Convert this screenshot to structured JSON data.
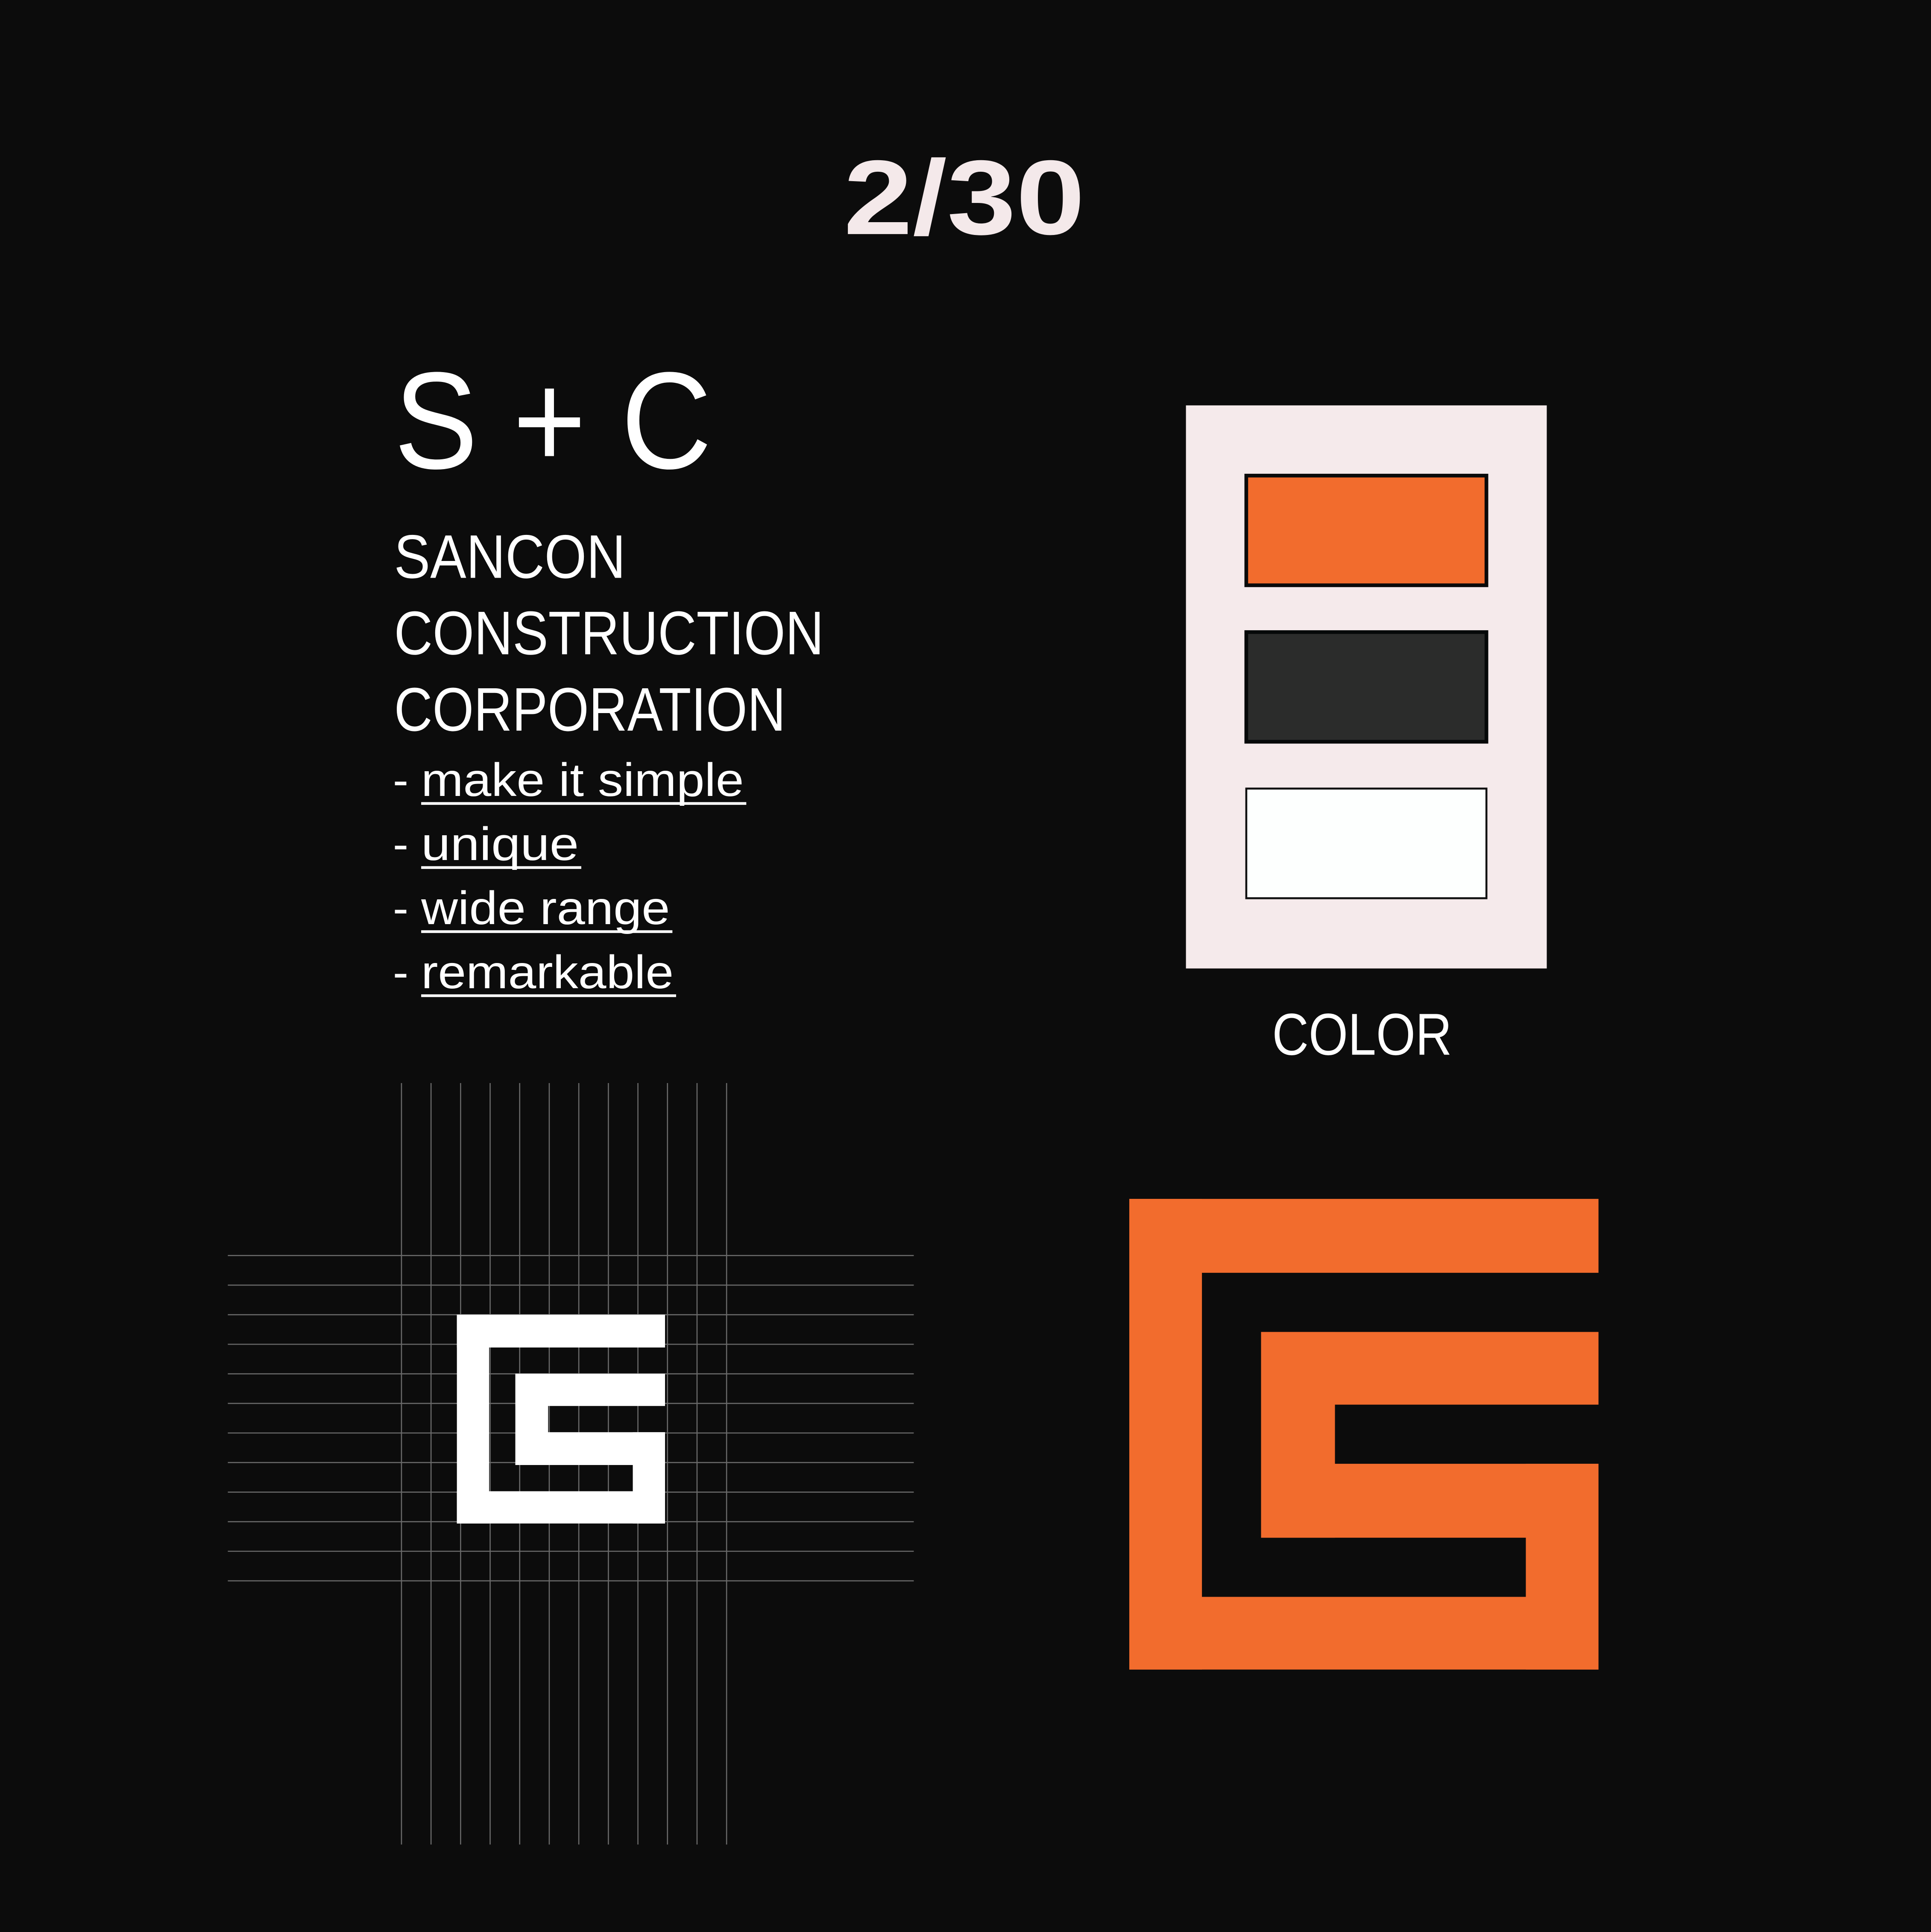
{
  "page_number": "2/30",
  "brand": {
    "monogram": "S + C",
    "name_lines": [
      "SANCON",
      "CONSTRUCTION",
      "CORPORATION"
    ],
    "values": [
      {
        "dash": "-",
        "label": "make it simple"
      },
      {
        "dash": "-",
        "label": "unique"
      },
      {
        "dash": "-",
        "label": "wide range"
      },
      {
        "dash": "-",
        "label": "remarkable"
      }
    ]
  },
  "palette": {
    "label": "COLOR",
    "swatches": [
      "#f26c2d",
      "#2b2c2b",
      "#fdfffe"
    ],
    "panel_color": "#f5eaeb"
  },
  "colors": {
    "background": "#0c0c0c",
    "accent": "#f26c2d",
    "logo_on_grid": "#ffffff",
    "grid_lines": "#6a6a6a",
    "page_number": "#f4e9ea"
  },
  "logo": {
    "construction_grid_lines_vertical": 12,
    "construction_grid_lines_horizontal": 12
  }
}
